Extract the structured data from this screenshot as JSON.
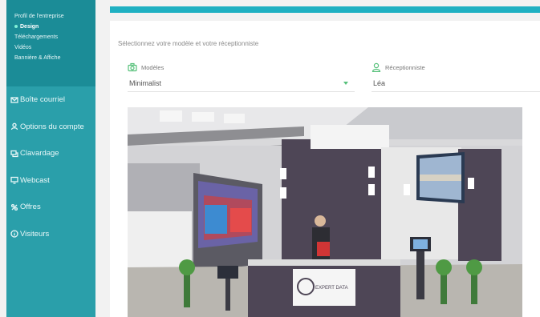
{
  "sidebar": {
    "sub_items": [
      {
        "label": "Profil de l'entreprise",
        "active": false
      },
      {
        "label": "Design",
        "active": true
      },
      {
        "label": "Téléchargements",
        "active": false
      },
      {
        "label": "Vidéos",
        "active": false
      },
      {
        "label": "Bannière & Affiche",
        "active": false
      }
    ],
    "nav_items": [
      {
        "label": "Boîte courriel",
        "icon": "mail-icon"
      },
      {
        "label": "Options du compte",
        "icon": "user-icon"
      },
      {
        "label": "Clavardage",
        "icon": "chat-icon"
      },
      {
        "label": "Webcast",
        "icon": "monitor-icon"
      },
      {
        "label": "Offres",
        "icon": "offers-icon"
      },
      {
        "label": "Visiteurs",
        "icon": "info-icon"
      }
    ]
  },
  "main": {
    "intro": "Sélectionnez votre modèle et votre réceptionniste",
    "models": {
      "label": "Modèles",
      "value": "Minimalist",
      "icon": "camera-icon"
    },
    "receptionist": {
      "label": "Réceptionniste",
      "value": "Léa",
      "icon": "person-icon"
    },
    "booth_sign": "EXPERT DATA"
  },
  "colors": {
    "sidebar": "#2a9faa",
    "sidebar_sub": "#1b8c97",
    "accent_bar": "#1fb0c2",
    "icon_green": "#56c07a"
  }
}
